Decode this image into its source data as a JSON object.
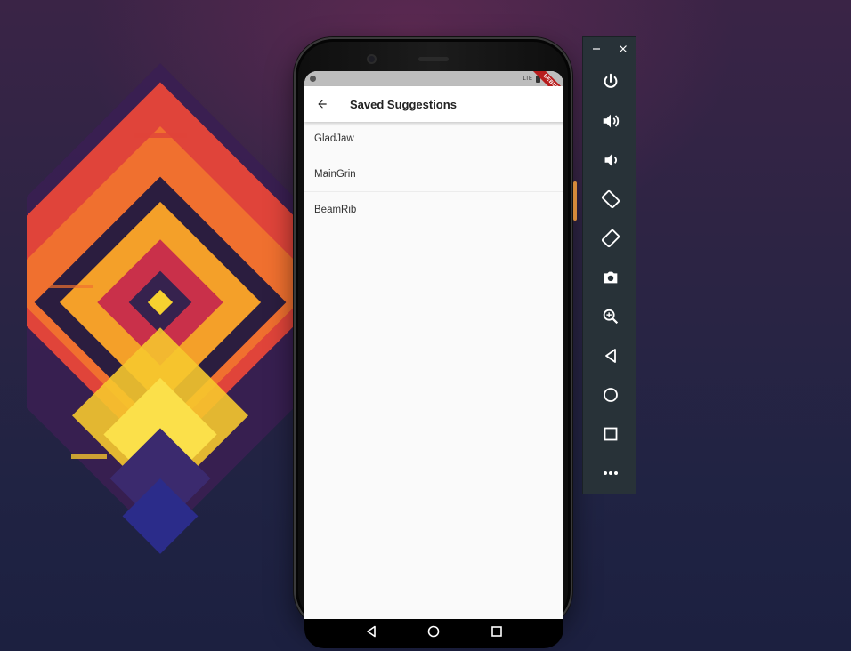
{
  "app_bar": {
    "title": "Saved Suggestions",
    "back_icon": "arrow-back-icon"
  },
  "status_bar": {
    "network": "LTE",
    "debug_banner": "DEBUG"
  },
  "saved_suggestions": [
    {
      "label": "GladJaw"
    },
    {
      "label": "MainGrin"
    },
    {
      "label": "BeamRib"
    }
  ],
  "nav_bar": {
    "buttons": [
      "back-triangle-icon",
      "home-circle-icon",
      "recents-square-icon"
    ]
  },
  "emulator_toolbar": {
    "window_controls": [
      "minimize-icon",
      "close-icon"
    ],
    "buttons": [
      "power-icon",
      "volume-up-icon",
      "volume-down-icon",
      "rotate-left-icon",
      "rotate-right-icon",
      "camera-icon",
      "zoom-icon",
      "back-icon",
      "home-icon",
      "overview-icon",
      "more-icon"
    ]
  },
  "colors": {
    "screen_bg": "#fafafa",
    "app_bar_bg": "#ffffff",
    "toolbar_bg": "#283238",
    "debug_ribbon": "#b71c1c"
  }
}
